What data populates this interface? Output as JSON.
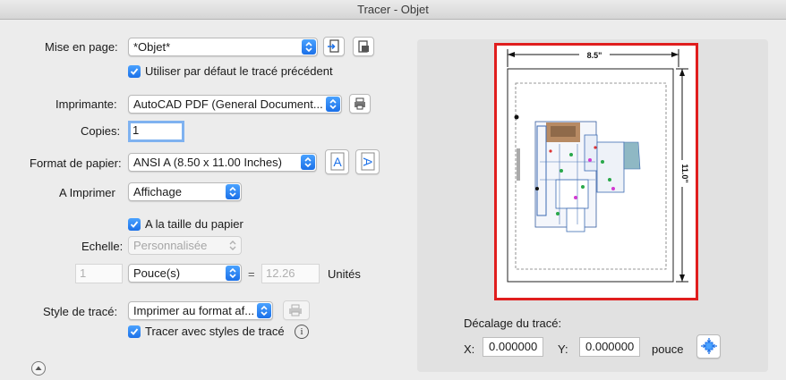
{
  "window": {
    "title": "Tracer - Objet"
  },
  "page_setup": {
    "label": "Mise en page:",
    "value": "*Objet*",
    "use_default_label": "Utiliser par défaut le tracé précédent",
    "use_default_checked": true
  },
  "printer": {
    "label": "Imprimante:",
    "value": "AutoCAD PDF (General Document..."
  },
  "copies": {
    "label": "Copies:",
    "value": "1"
  },
  "paper_size": {
    "label": "Format de papier:",
    "value": "ANSI A (8.50 x 11.00 Inches)"
  },
  "plot_area": {
    "label": "A Imprimer",
    "value": "Affichage"
  },
  "fit_to_paper": {
    "label": "A la taille du papier",
    "checked": true
  },
  "scale": {
    "label": "Echelle:",
    "value": "Personnalisée",
    "value1": "1",
    "unit": "Pouce(s)",
    "equals": "=",
    "value2": "12.26",
    "units_label": "Unités"
  },
  "plot_style": {
    "label": "Style de tracé:",
    "value": "Imprimer au format af...",
    "plot_with_styles_label": "Tracer avec styles de tracé",
    "plot_with_styles_checked": true
  },
  "preview": {
    "width_label": "8.5\"",
    "height_label": "11.0\"",
    "offset_title": "Décalage du tracé:",
    "x_label": "X:",
    "x_value": "0.000000",
    "y_label": "Y:",
    "y_value": "0.000000",
    "unit": "pouce"
  },
  "colors": {
    "accent": "#1b70e8",
    "highlight_border": "#e01e1e"
  }
}
